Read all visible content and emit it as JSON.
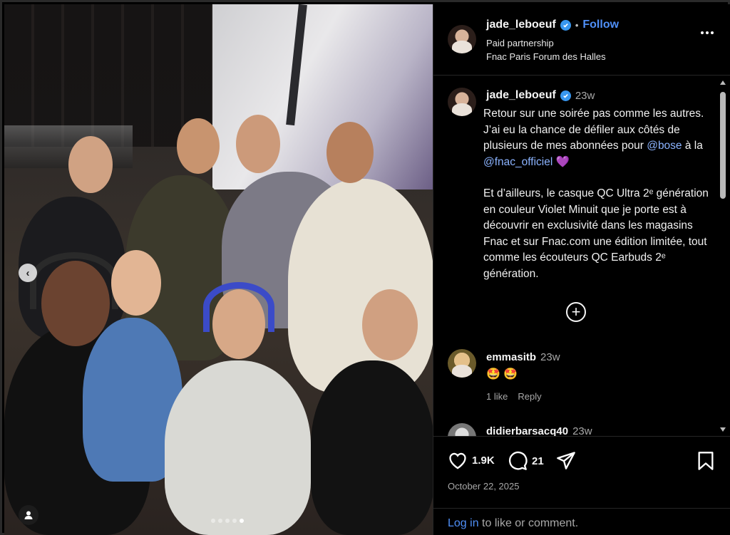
{
  "post": {
    "username": "jade_leboeuf",
    "follow_label": "Follow",
    "sep": "•",
    "paid_partnership": "Paid partnership",
    "location": "Fnac Paris Forum des Halles"
  },
  "caption": {
    "username": "jade_leboeuf",
    "time": "23w",
    "paragraph1_text": "Retour sur une soirée pas comme les autres. J’ai eu la chance de défiler aux côtés de plusieurs de mes abonnées pour ",
    "mention_bose": "@bose",
    "mid_text": " à la ",
    "mention_fnac": "@fnac_officiel",
    "heart_emoji": "💜",
    "paragraph2": "Et d’ailleurs, le casque QC Ultra 2ᵉ génération en couleur Violet Minuit que je porte est à découvrir en exclusivité dans les magasins Fnac et sur Fnac.com une édition limitée, tout comme les écouteurs QC Earbuds 2ᵉ génération."
  },
  "load_more_label": "+",
  "comments": [
    {
      "username": "emmasitb",
      "time": "23w",
      "text": "🤩 🤩",
      "likes": "1 like",
      "reply": "Reply"
    },
    {
      "username": "didierbarsacq40",
      "time": "23w"
    }
  ],
  "actions": {
    "likes": "1.9K",
    "comments": "21",
    "date": "October 22, 2025"
  },
  "footer": {
    "login_label": "Log in",
    "suffix": " to like or comment."
  },
  "carousel": {
    "total": 5,
    "active_index": 4
  },
  "colors": {
    "link": "#4f8ff7",
    "mention": "#8bb3ff",
    "verified": "#3897f0",
    "background": "#000000"
  }
}
